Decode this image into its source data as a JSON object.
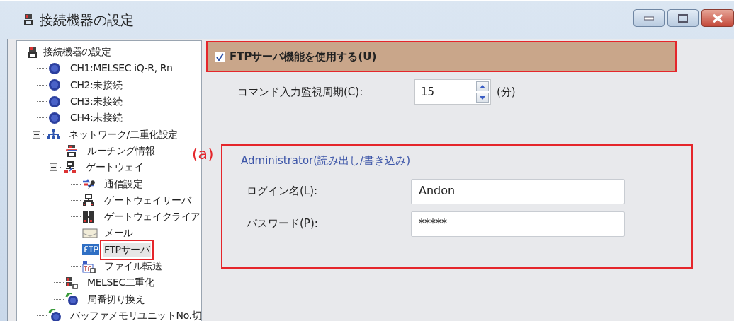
{
  "window": {
    "title": "接続機器の設定",
    "controls": [
      {
        "kind": "minimize"
      },
      {
        "kind": "maximize"
      },
      {
        "kind": "close"
      }
    ]
  },
  "tree": {
    "label": "接続機器の設定",
    "kind": "device",
    "children": [
      {
        "label": "CH1:MELSEC iQ-R, Rn",
        "kind": "channel",
        "selected": false
      },
      {
        "label": "CH2:未接続",
        "kind": "channel",
        "selected": false
      },
      {
        "label": "CH3:未接続",
        "kind": "channel",
        "selected": false
      },
      {
        "label": "CH4:未接続",
        "kind": "channel",
        "selected": false
      },
      {
        "label": "ネットワーク/二重化設定",
        "kind": "network",
        "expanded": true,
        "selected": false,
        "children": [
          {
            "label": "ルーチング情報",
            "kind": "routing",
            "selected": false
          },
          {
            "label": "ゲートウェイ",
            "kind": "gateway",
            "expanded": true,
            "selected": false,
            "children": [
              {
                "label": "通信設定",
                "kind": "tool",
                "selected": false
              },
              {
                "label": "ゲートウェイサーバ",
                "kind": "server",
                "selected": false
              },
              {
                "label": "ゲートウェイクライア",
                "kind": "client",
                "selected": false
              },
              {
                "label": "メール",
                "kind": "mail",
                "selected": false
              },
              {
                "label": "FTPサーバ",
                "kind": "ftp",
                "selected": true
              },
              {
                "label": "ファイル転送",
                "kind": "file",
                "selected": false
              }
            ]
          },
          {
            "label": "MELSEC二重化",
            "kind": "redundant",
            "selected": false
          },
          {
            "label": "局番切り換え",
            "kind": "station",
            "selected": false
          }
        ]
      },
      {
        "label": "バッファメモリユニットNo.切",
        "kind": "station",
        "selected": false
      }
    ]
  },
  "ftp_enable": {
    "label": "FTPサーバ機能を使用する(U)",
    "checked": true
  },
  "command_period": {
    "label": "コマンド入力監視周期(C):",
    "value": "15",
    "unit": "(分)"
  },
  "admin_group": {
    "legend": "Administrator(読み出し/書き込み)",
    "fields": [
      {
        "label": "ログイン名(L):",
        "value": "Andon"
      },
      {
        "label": "パスワード(P):",
        "value": "*****"
      }
    ]
  },
  "annotations": [
    {
      "label": "(a)"
    }
  ]
}
